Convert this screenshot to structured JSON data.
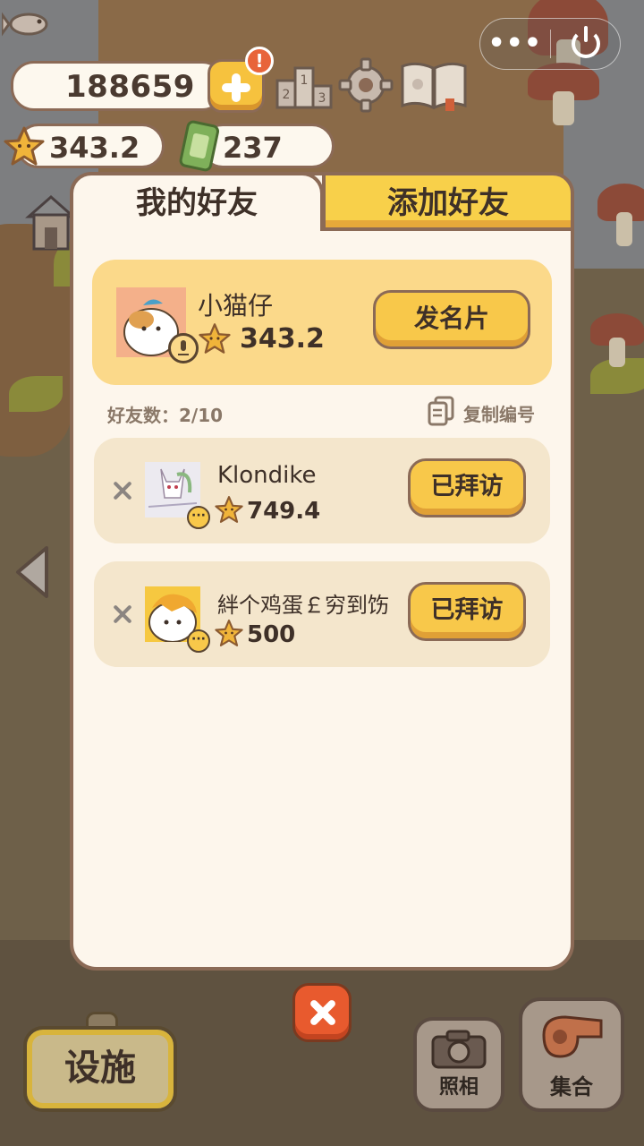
{
  "system": {
    "more_label": "•••"
  },
  "hud": {
    "fish_count": "188659",
    "alert_badge": "!",
    "star_value": "343.2",
    "ticket_count": "237"
  },
  "dialog": {
    "tabs": [
      {
        "label": "我的好友",
        "active": true
      },
      {
        "label": "添加好友",
        "active": false
      }
    ],
    "me": {
      "name": "小猫仔",
      "score": "343.2",
      "card_button": "发名片"
    },
    "friend_count_label": "好友数：2/10",
    "copy_id_label": "复制编号",
    "friends": [
      {
        "name": "Klondike",
        "score": "749.4",
        "action": "已拜访"
      },
      {
        "name": "絆个鸡蛋￡穷到饬",
        "score": "500",
        "action": "已拜访"
      }
    ]
  },
  "bottom_bar": {
    "facility_label": "设施",
    "photo_label": "照相",
    "gather_label": "集合"
  },
  "colors": {
    "accent_yellow": "#f8c84a",
    "panel_bg": "#fdf6ec",
    "border_brown": "#8b6a56",
    "close_red": "#e85a2e"
  },
  "icons": [
    "fish-icon",
    "plus-icon",
    "rank-icon",
    "gear-icon",
    "book-icon",
    "star-icon",
    "ticket-icon",
    "house-icon",
    "copy-icon",
    "close-icon",
    "arrow-left-icon",
    "camera-icon",
    "whistle-icon",
    "power-icon"
  ]
}
